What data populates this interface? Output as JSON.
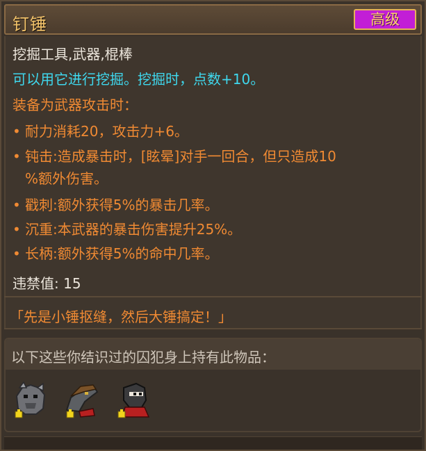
{
  "item": {
    "name": "钉锤",
    "rarity": "高级",
    "rarity_color": "#c21ed6",
    "category": "挖掘工具,武器,棍棒",
    "dig_description": "可以用它进行挖掘。挖掘时，点数+10。",
    "weapon_header": "装备为武器攻击时：",
    "bullets": [
      "耐力消耗20，攻击力+6。",
      "钝击:造成暴击时，[眩晕]对手一回合，但只造成10",
      "%额外伤害。",
      "戳刺:额外获得5%的暴击几率。",
      "沉重:本武器的暴击伤害提升25%。",
      "长柄:额外获得5%的命中几率。"
    ],
    "contraband": "违禁值: 15",
    "flavor": "「先是小锤抠缝，然后大锤搞定！」"
  },
  "owners": {
    "label": "以下这些你结识过的囚犯身上持有此物品：",
    "portraits": [
      {
        "icon": "rhino-prisoner-portrait-icon"
      },
      {
        "icon": "crocodile-prisoner-portrait-icon"
      },
      {
        "icon": "masked-prisoner-portrait-icon"
      }
    ]
  }
}
